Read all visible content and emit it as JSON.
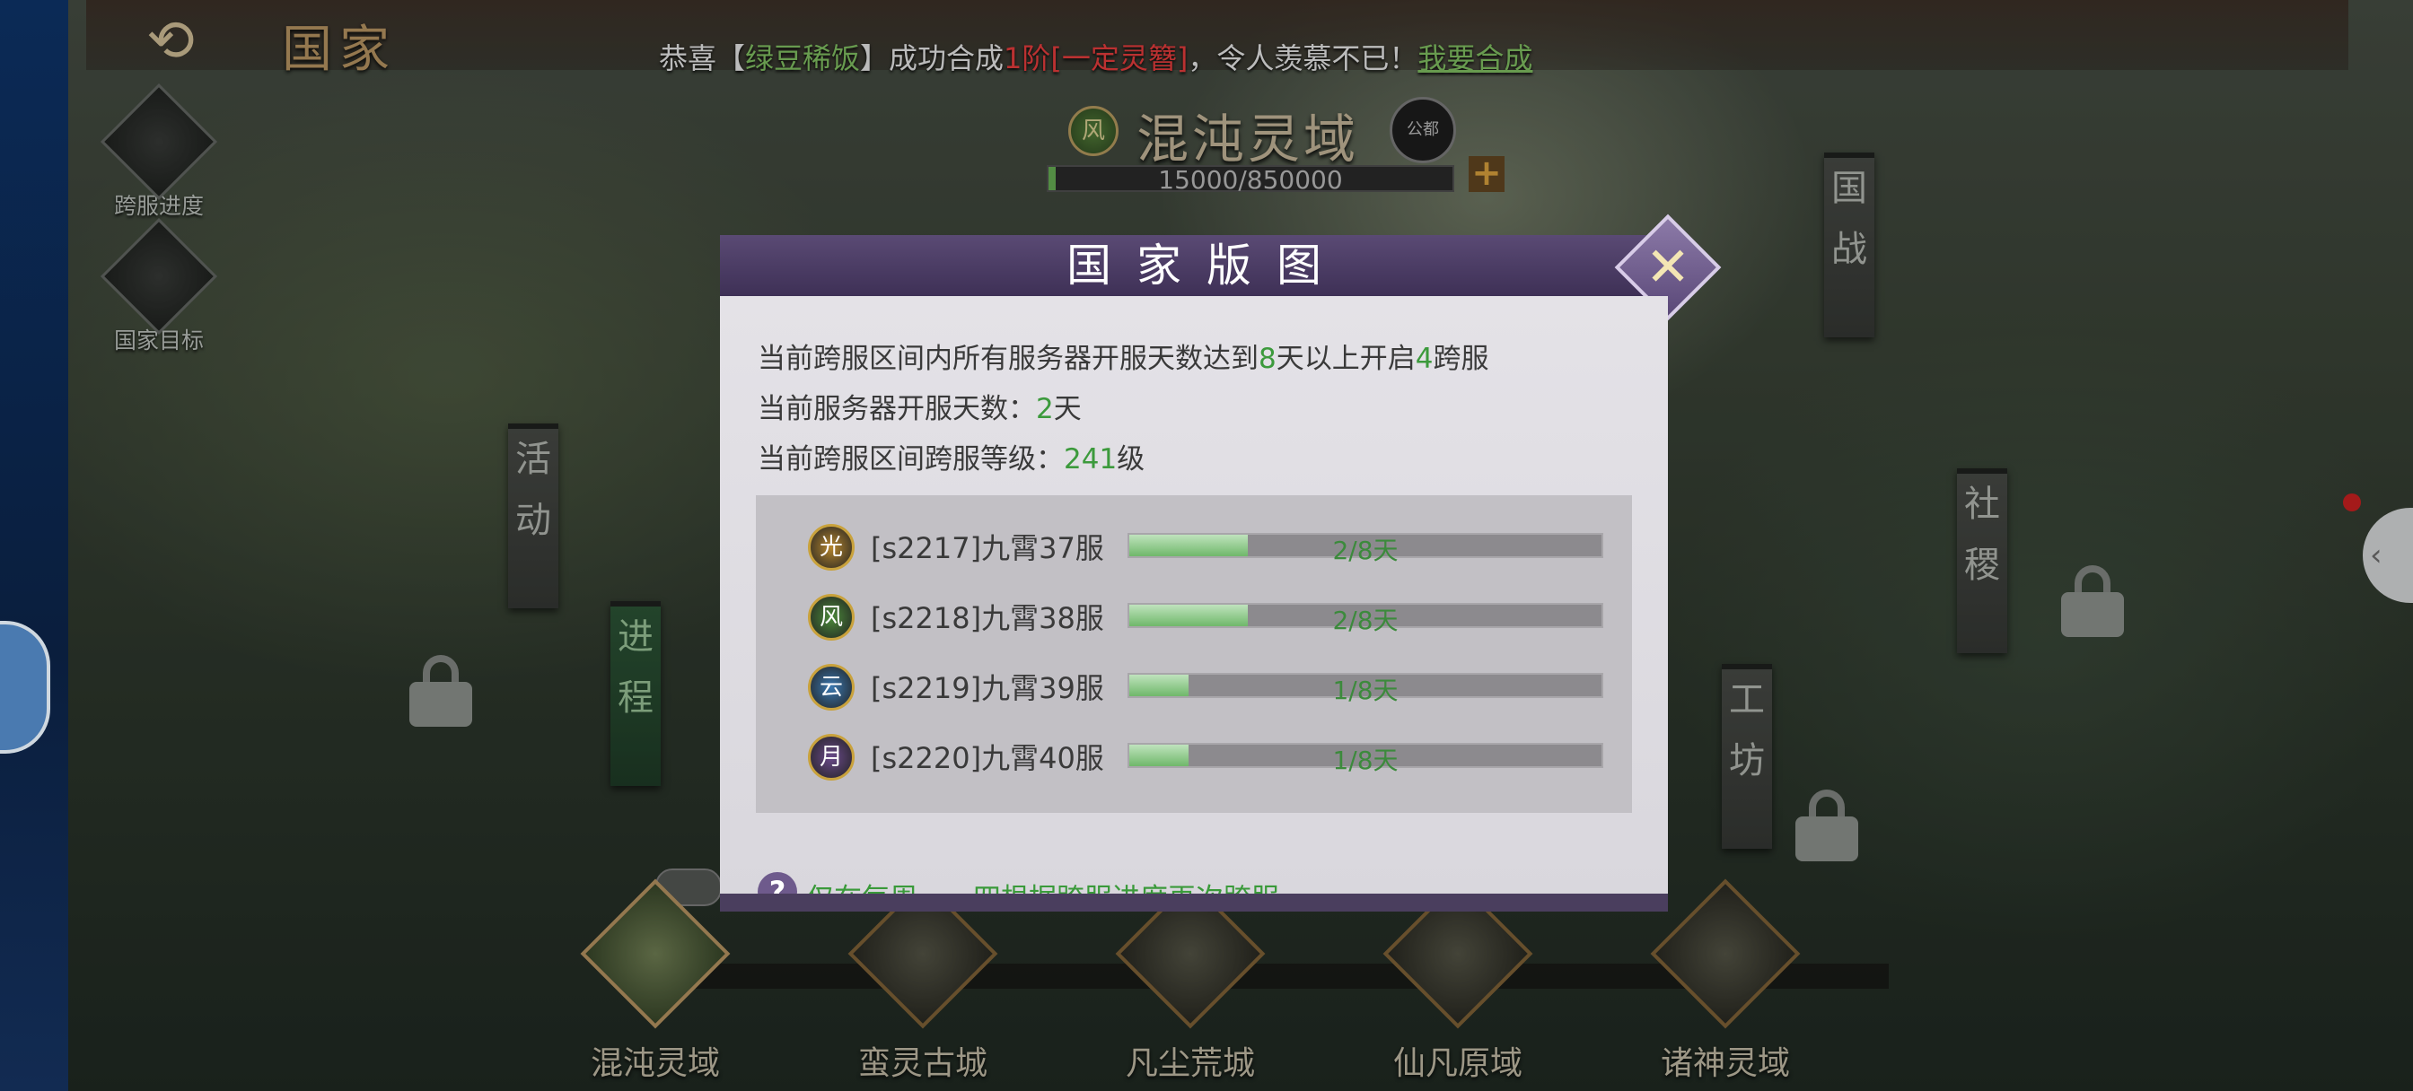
{
  "header": {
    "back_icon": "back-arrow-icon",
    "title": "国家"
  },
  "ticker": {
    "prefix": "恭喜【",
    "player": "绿豆稀饭",
    "mid": "】成功合成",
    "item": "1阶[一定灵簪]",
    "suffix": "，令人羡慕不已！",
    "link": "我要合成"
  },
  "side_buttons": [
    {
      "icon": "cross-server-progress-icon",
      "label": "跨服进度"
    },
    {
      "icon": "nation-goal-icon",
      "label": "国家目标"
    }
  ],
  "area": {
    "badge": "风",
    "name": "混沌灵域",
    "emblem": "公都",
    "progress_text": "15000/850000",
    "progress_fraction": 0.0176
  },
  "banners": {
    "guozhan": [
      "国",
      "战"
    ],
    "huodong": [
      "活",
      "动"
    ],
    "jincheng": [
      "进",
      "程"
    ],
    "sheji": [
      "社",
      "稷"
    ],
    "gongfang": [
      "工",
      "坊"
    ]
  },
  "cities": [
    {
      "name": "混沌灵域",
      "active": true
    },
    {
      "name": "蛮灵古城",
      "active": false
    },
    {
      "name": "凡尘荒城",
      "active": false
    },
    {
      "name": "仙凡原域",
      "active": false
    },
    {
      "name": "诸神灵域",
      "active": false
    }
  ],
  "modal": {
    "title": "国家版图",
    "close_icon": "close-x-icon",
    "info1": {
      "a": "当前跨服区间内所有服务器开服天数达到",
      "days": "8",
      "b": "天以上开启",
      "count": "4",
      "c": "跨服"
    },
    "info2": {
      "a": "当前服务器开服天数：",
      "days": "2",
      "b": "天"
    },
    "info3": {
      "a": "当前跨服区间跨服等级：",
      "level": "241",
      "b": "级"
    },
    "servers": [
      {
        "icon": "光",
        "color": "#b5862e",
        "name": "[s2217]九霄37服",
        "progress": "2/8天",
        "fraction": 0.25
      },
      {
        "icon": "风",
        "color": "#4c8a3a",
        "name": "[s2218]九霄38服",
        "progress": "2/8天",
        "fraction": 0.25
      },
      {
        "icon": "云",
        "color": "#3a78b0",
        "name": "[s2219]九霄39服",
        "progress": "1/8天",
        "fraction": 0.125
      },
      {
        "icon": "月",
        "color": "#6a4a8a",
        "name": "[s2220]九霄40服",
        "progress": "1/8天",
        "fraction": 0.125
      }
    ],
    "hint_icon": "question-mark-icon",
    "hint": "仅在每周一、四根据跨服进度再次跨服"
  }
}
